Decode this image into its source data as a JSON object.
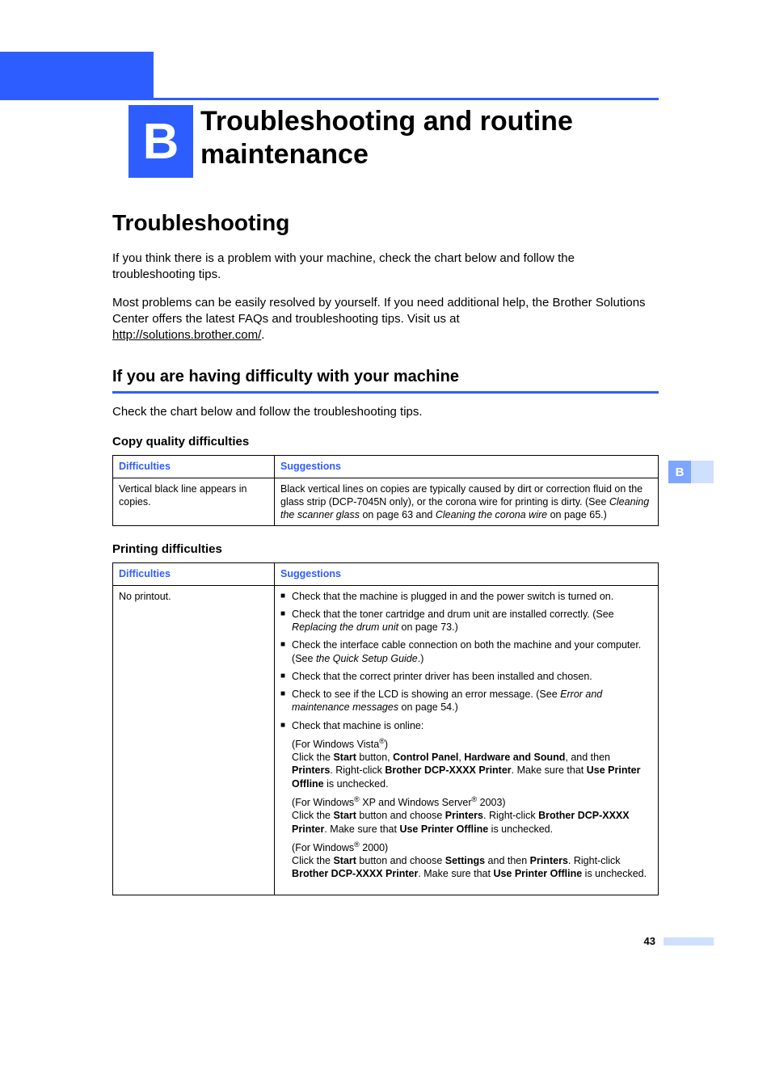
{
  "chapter": {
    "letter": "B",
    "title": "Troubleshooting and routine maintenance"
  },
  "section": {
    "heading": "Troubleshooting"
  },
  "intro": {
    "p1": "If you think there is a problem with your machine, check the chart below and follow the troubleshooting tips.",
    "p2a": "Most problems can be easily resolved by yourself. If you need additional help, the Brother Solutions Center offers the latest FAQs and troubleshooting tips. Visit us at ",
    "link": "http://solutions.brother.com/",
    "p2b": "."
  },
  "subsection": {
    "heading": "If you are having difficulty with your machine",
    "para": "Check the chart below and follow the troubleshooting tips."
  },
  "table1": {
    "title": "Copy quality difficulties",
    "headers": {
      "c1": "Difficulties",
      "c2": "Suggestions"
    },
    "row": {
      "difficulty": "Vertical black line appears in copies.",
      "suggestion_a": "Black vertical lines on copies are typically caused by dirt or correction fluid on the glass strip (DCP-7045N only), or the corona wire for printing is dirty. (See ",
      "suggestion_link1": "Cleaning the scanner glass",
      "suggestion_mid": " on page 63 and ",
      "suggestion_link2": "Cleaning the corona wire",
      "suggestion_b": " on page 65.)"
    }
  },
  "table2": {
    "title": "Printing difficulties",
    "headers": {
      "c1": "Difficulties",
      "c2": "Suggestions"
    },
    "row": {
      "difficulty": "No printout.",
      "b1": "Check that the machine is plugged in and the power switch is turned on.",
      "b2a": "Check that the toner cartridge and drum unit are installed correctly. (See ",
      "b2link": "Replacing the drum unit",
      "b2b": " on page 73.)",
      "b3a": "Check the interface cable connection on both the machine and your computer. (See ",
      "b3i": "the Quick Setup Guide",
      "b3b": ".)",
      "b4": "Check that the correct printer driver has been installed and chosen.",
      "b5a": "Check to see if the LCD is showing an error message. (See ",
      "b5link": "Error and maintenance messages",
      "b5b": " on page 54.)",
      "b6": "Check that machine is online:",
      "vista_label_a": "(For Windows Vista",
      "vista_label_b": ")",
      "vista_a": "Click the ",
      "vista_start": "Start",
      "vista_b": " button, ",
      "vista_cp": "Control Panel",
      "vista_c": ", ",
      "vista_hs": "Hardware and Sound",
      "vista_d": ", and then ",
      "vista_pr": "Printers",
      "vista_e": ". Right-click ",
      "vista_bp": "Brother DCP-XXXX Printer",
      "vista_f": ". Make sure that ",
      "vista_upo": "Use Printer Offline",
      "vista_g": " is unchecked.",
      "xp_label_a": "(For Windows",
      "xp_label_b": " XP and Windows Server",
      "xp_label_c": " 2003)",
      "xp_a": "Click the ",
      "xp_start": "Start",
      "xp_b": " button and choose ",
      "xp_pr": "Printers",
      "xp_c": ". Right-click ",
      "xp_bp": "Brother DCP-XXXX Printer",
      "xp_d": ". Make sure that ",
      "xp_upo": "Use Printer Offline",
      "xp_e": " is unchecked.",
      "w2k_label_a": "(For Windows",
      "w2k_label_b": " 2000)",
      "w2k_a": "Click the ",
      "w2k_start": "Start",
      "w2k_b": " button and choose ",
      "w2k_set": "Settings",
      "w2k_c": " and then ",
      "w2k_pr": "Printers",
      "w2k_d": ". Right-click ",
      "w2k_bp": "Brother DCP-XXXX Printer",
      "w2k_e": ". Make sure that ",
      "w2k_upo": "Use Printer Offline",
      "w2k_f": " is unchecked."
    }
  },
  "sidetab": "B",
  "reg": "®",
  "pagenum": "43"
}
